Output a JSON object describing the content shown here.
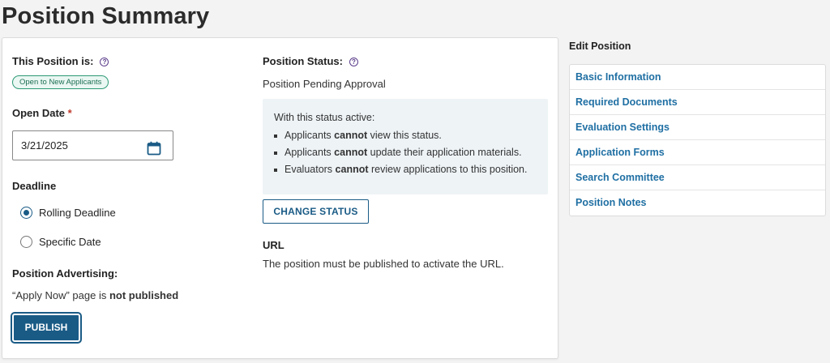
{
  "page": {
    "title": "Position Summary"
  },
  "left": {
    "position_is_label": "This Position is:",
    "badge": "Open to New Applicants",
    "open_date_label": "Open Date",
    "required_mark": "*",
    "open_date_value": "3/21/2025",
    "deadline_label": "Deadline",
    "deadline_options": [
      {
        "label": "Rolling Deadline",
        "selected": true
      },
      {
        "label": "Specific Date",
        "selected": false
      }
    ],
    "advertising_label": "Position Advertising:",
    "apply_now_prefix": "“Apply Now” page is",
    "apply_now_status": "not published",
    "publish_button": "PUBLISH"
  },
  "status": {
    "label": "Position Status:",
    "value": "Position Pending Approval",
    "info_intro": "With this status active:",
    "info_items": [
      {
        "pre": "Applicants",
        "bold": "cannot",
        "post": "view this status."
      },
      {
        "pre": "Applicants",
        "bold": "cannot",
        "post": "update their application materials."
      },
      {
        "pre": "Evaluators",
        "bold": "cannot",
        "post": "review applications to this position."
      }
    ],
    "change_button": "CHANGE STATUS",
    "url_label": "URL",
    "url_text": "The position must be published to activate the URL."
  },
  "sidebar": {
    "title": "Edit Position",
    "items": [
      "Basic Information",
      "Required Documents",
      "Evaluation Settings",
      "Application Forms",
      "Search Committee",
      "Position Notes"
    ]
  },
  "colors": {
    "primary": "#1a5b86",
    "link": "#1f6fa3",
    "badge": "#2e9a77"
  },
  "icons": {
    "help": "question-circle-icon",
    "calendar": "calendar-icon"
  }
}
